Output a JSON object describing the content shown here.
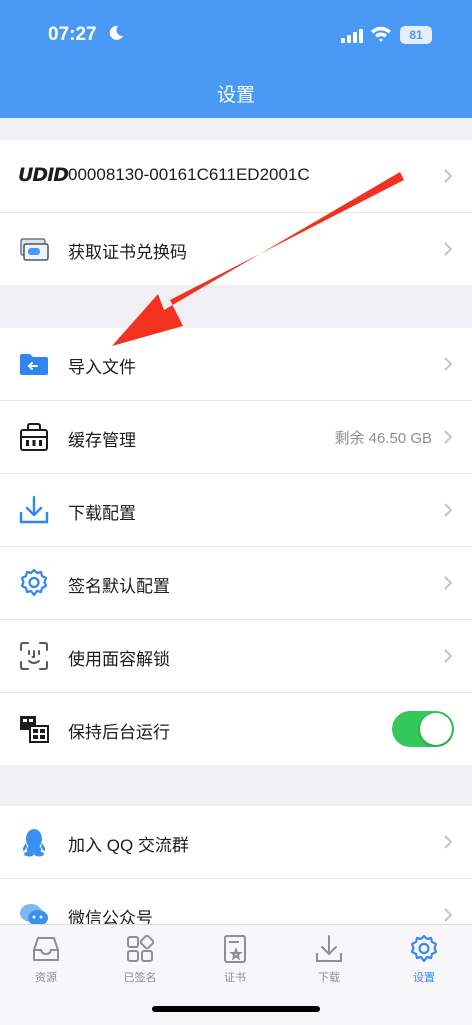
{
  "status_bar": {
    "time": "07:27",
    "battery": "81"
  },
  "header": {
    "title": "设置"
  },
  "group1": {
    "udid_badge": "UDID",
    "udid_value": "00008130-00161C611ED2001C",
    "redeem_label": "获取证书兑换码"
  },
  "group2": {
    "import_label": "导入文件",
    "cache_label": "缓存管理",
    "cache_value": "剩余 46.50 GB",
    "download_label": "下载配置",
    "sign_label": "签名默认配置",
    "faceid_label": "使用面容解锁",
    "background_label": "保持后台运行",
    "background_on": true
  },
  "group3": {
    "qq_label": "加入 QQ 交流群",
    "wechat_label": "微信公众号"
  },
  "tabbar": {
    "tabs": [
      {
        "label": "资源"
      },
      {
        "label": "已签名"
      },
      {
        "label": "证书"
      },
      {
        "label": "下载"
      },
      {
        "label": "设置"
      }
    ],
    "active": "设置"
  },
  "colors": {
    "header": "#4a9af5",
    "accent": "#3a87f0",
    "toggle": "#34c759",
    "arrow": "#f2321e"
  },
  "icons": [
    "moon-icon",
    "signal-icon",
    "wifi-icon",
    "battery-icon",
    "udid-icon",
    "card-icon",
    "folder-icon",
    "bag-icon",
    "download-icon",
    "gear-icon",
    "faceid-icon",
    "background-icon",
    "qq-icon",
    "wechat-icon",
    "inbox-icon",
    "grid-icon",
    "certificate-icon"
  ]
}
